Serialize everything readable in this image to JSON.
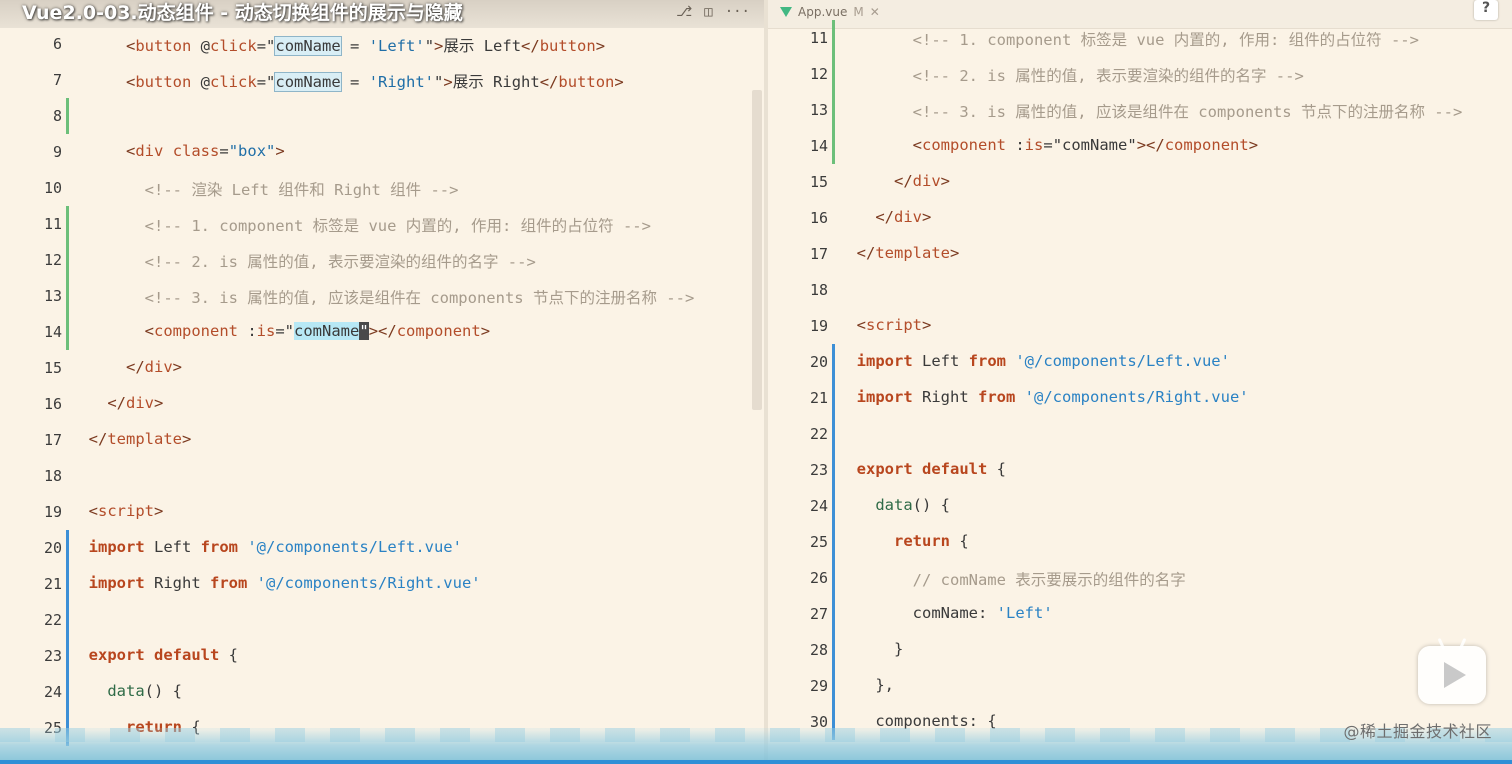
{
  "video_title": "Vue2.0-03.动态组件 - 动态切换组件的展示与隐藏",
  "left_pane": {
    "tab_partial": "App.vue M",
    "actions": [
      "⎇",
      "◫",
      "···"
    ],
    "lines": [
      {
        "n": "6",
        "gutter": "",
        "tokens": [
          [
            "      ",
            "tk-plain"
          ],
          [
            "<",
            "tk-tag"
          ],
          [
            "button",
            "tk-el"
          ],
          [
            " @",
            "tk-plain"
          ],
          [
            "click",
            "tk-dir"
          ],
          [
            "=\"",
            "tk-plain"
          ],
          [
            "comName",
            "hl"
          ],
          [
            " = ",
            "tk-plain"
          ],
          [
            "'Left'",
            "tk-str"
          ],
          [
            "\"",
            "tk-plain"
          ],
          [
            ">",
            "tk-tag"
          ],
          [
            "展示 Left",
            "tk-plain"
          ],
          [
            "</",
            "tk-tag"
          ],
          [
            "button",
            "tk-el"
          ],
          [
            ">",
            "tk-tag"
          ]
        ]
      },
      {
        "n": "7",
        "gutter": "",
        "tokens": [
          [
            "      ",
            "tk-plain"
          ],
          [
            "<",
            "tk-tag"
          ],
          [
            "button",
            "tk-el"
          ],
          [
            " @",
            "tk-plain"
          ],
          [
            "click",
            "tk-dir"
          ],
          [
            "=\"",
            "tk-plain"
          ],
          [
            "comName",
            "hl"
          ],
          [
            " = ",
            "tk-plain"
          ],
          [
            "'Right'",
            "tk-str"
          ],
          [
            "\"",
            "tk-plain"
          ],
          [
            ">",
            "tk-tag"
          ],
          [
            "展示 Right",
            "tk-plain"
          ],
          [
            "</",
            "tk-tag"
          ],
          [
            "button",
            "tk-el"
          ],
          [
            ">",
            "tk-tag"
          ]
        ]
      },
      {
        "n": "8",
        "gutter": "green",
        "tokens": []
      },
      {
        "n": "9",
        "gutter": "",
        "tokens": [
          [
            "      ",
            "tk-plain"
          ],
          [
            "<",
            "tk-tag"
          ],
          [
            "div",
            "tk-el"
          ],
          [
            " ",
            "tk-plain"
          ],
          [
            "class",
            "tk-attr"
          ],
          [
            "=",
            "tk-plain"
          ],
          [
            "\"box\"",
            "tk-str"
          ],
          [
            ">",
            "tk-tag"
          ]
        ]
      },
      {
        "n": "10",
        "gutter": "",
        "tokens": [
          [
            "        ",
            "tk-plain"
          ],
          [
            "<!-- 渲染 Left 组件和 Right 组件 -->",
            "tk-comment"
          ]
        ]
      },
      {
        "n": "11",
        "gutter": "green",
        "tokens": [
          [
            "        ",
            "tk-plain"
          ],
          [
            "<!-- 1. component 标签是 vue 内置的, 作用: 组件的占位符 -->",
            "tk-comment"
          ]
        ]
      },
      {
        "n": "12",
        "gutter": "green",
        "tokens": [
          [
            "        ",
            "tk-plain"
          ],
          [
            "<!-- 2. is 属性的值, 表示要渲染的组件的名字 -->",
            "tk-comment"
          ]
        ]
      },
      {
        "n": "13",
        "gutter": "green",
        "tokens": [
          [
            "        ",
            "tk-plain"
          ],
          [
            "<!-- 3. is 属性的值, 应该是组件在 components 节点下的注册名称 -->",
            "tk-comment"
          ]
        ]
      },
      {
        "n": "14",
        "gutter": "green",
        "tokens": [
          [
            "        ",
            "tk-plain"
          ],
          [
            "<",
            "tk-tag"
          ],
          [
            "component",
            "tk-el"
          ],
          [
            " :",
            "tk-plain"
          ],
          [
            "is",
            "tk-dir"
          ],
          [
            "=\"",
            "tk-plain"
          ],
          [
            "comName",
            "sel"
          ],
          [
            "\"",
            "cursor"
          ],
          [
            ">",
            "tk-tag"
          ],
          [
            "</",
            "tk-tag"
          ],
          [
            "component",
            "tk-el"
          ],
          [
            ">",
            "tk-tag"
          ]
        ]
      },
      {
        "n": "15",
        "gutter": "",
        "tokens": [
          [
            "      ",
            "tk-plain"
          ],
          [
            "</",
            "tk-tag"
          ],
          [
            "div",
            "tk-el"
          ],
          [
            ">",
            "tk-tag"
          ]
        ]
      },
      {
        "n": "16",
        "gutter": "",
        "tokens": [
          [
            "    ",
            "tk-plain"
          ],
          [
            "</",
            "tk-tag"
          ],
          [
            "div",
            "tk-el"
          ],
          [
            ">",
            "tk-tag"
          ]
        ]
      },
      {
        "n": "17",
        "gutter": "",
        "tokens": [
          [
            "  ",
            "tk-plain"
          ],
          [
            "</",
            "tk-tag"
          ],
          [
            "template",
            "tk-el"
          ],
          [
            ">",
            "tk-tag"
          ]
        ]
      },
      {
        "n": "18",
        "gutter": "",
        "tokens": []
      },
      {
        "n": "19",
        "gutter": "",
        "tokens": [
          [
            "  ",
            "tk-plain"
          ],
          [
            "<",
            "tk-tag"
          ],
          [
            "script",
            "tk-el"
          ],
          [
            ">",
            "tk-tag"
          ]
        ]
      },
      {
        "n": "20",
        "gutter": "blue",
        "tokens": [
          [
            "  ",
            "tk-plain"
          ],
          [
            "import",
            "tk-kw"
          ],
          [
            " Left ",
            "tk-plain"
          ],
          [
            "from",
            "tk-kw"
          ],
          [
            " ",
            "tk-plain"
          ],
          [
            "'@/components/Left.vue'",
            "tk-strblue"
          ]
        ]
      },
      {
        "n": "21",
        "gutter": "blue",
        "tokens": [
          [
            "  ",
            "tk-plain"
          ],
          [
            "import",
            "tk-kw"
          ],
          [
            " Right ",
            "tk-plain"
          ],
          [
            "from",
            "tk-kw"
          ],
          [
            " ",
            "tk-plain"
          ],
          [
            "'@/components/Right.vue'",
            "tk-strblue"
          ]
        ]
      },
      {
        "n": "22",
        "gutter": "blue",
        "tokens": []
      },
      {
        "n": "23",
        "gutter": "blue",
        "tokens": [
          [
            "  ",
            "tk-plain"
          ],
          [
            "export",
            "tk-kw"
          ],
          [
            " ",
            "tk-plain"
          ],
          [
            "default",
            "tk-kw"
          ],
          [
            " {",
            "tk-plain"
          ]
        ]
      },
      {
        "n": "24",
        "gutter": "blue",
        "tokens": [
          [
            "    ",
            "tk-plain"
          ],
          [
            "data",
            "tk-ident"
          ],
          [
            "() {",
            "tk-plain"
          ]
        ]
      },
      {
        "n": "25",
        "gutter": "blue",
        "tokens": [
          [
            "      ",
            "tk-plain"
          ],
          [
            "return",
            "tk-kw"
          ],
          [
            " {",
            "tk-plain"
          ]
        ]
      }
    ]
  },
  "right_pane": {
    "tab_label": "App.vue",
    "tab_modified": "M",
    "tab_close": "✕",
    "help": "?",
    "lines": [
      {
        "n": "11",
        "gutter": "green",
        "tokens": [
          [
            "        ",
            "tk-plain"
          ],
          [
            "<!-- 1. component 标签是 vue 内置的, 作用: 组件的占位符 -->",
            "tk-comment"
          ]
        ]
      },
      {
        "n": "12",
        "gutter": "green",
        "tokens": [
          [
            "        ",
            "tk-plain"
          ],
          [
            "<!-- 2. is 属性的值, 表示要渲染的组件的名字 -->",
            "tk-comment"
          ]
        ]
      },
      {
        "n": "13",
        "gutter": "green",
        "tokens": [
          [
            "        ",
            "tk-plain"
          ],
          [
            "<!-- 3. is 属性的值, 应该是组件在 components 节点下的注册名称 -->",
            "tk-comment"
          ]
        ]
      },
      {
        "n": "14",
        "gutter": "green",
        "tokens": [
          [
            "        ",
            "tk-plain"
          ],
          [
            "<",
            "tk-tag"
          ],
          [
            "component",
            "tk-el"
          ],
          [
            " :",
            "tk-plain"
          ],
          [
            "is",
            "tk-dir"
          ],
          [
            "=",
            "tk-plain"
          ],
          [
            "\"comName\"",
            "tk-plain"
          ],
          [
            ">",
            "tk-tag"
          ],
          [
            "</",
            "tk-tag"
          ],
          [
            "component",
            "tk-el"
          ],
          [
            ">",
            "tk-tag"
          ]
        ]
      },
      {
        "n": "15",
        "gutter": "",
        "tokens": [
          [
            "      ",
            "tk-plain"
          ],
          [
            "</",
            "tk-tag"
          ],
          [
            "div",
            "tk-el"
          ],
          [
            ">",
            "tk-tag"
          ]
        ]
      },
      {
        "n": "16",
        "gutter": "",
        "tokens": [
          [
            "    ",
            "tk-plain"
          ],
          [
            "</",
            "tk-tag"
          ],
          [
            "div",
            "tk-el"
          ],
          [
            ">",
            "tk-tag"
          ]
        ]
      },
      {
        "n": "17",
        "gutter": "",
        "tokens": [
          [
            "  ",
            "tk-plain"
          ],
          [
            "</",
            "tk-tag"
          ],
          [
            "template",
            "tk-el"
          ],
          [
            ">",
            "tk-tag"
          ]
        ]
      },
      {
        "n": "18",
        "gutter": "",
        "tokens": []
      },
      {
        "n": "19",
        "gutter": "",
        "tokens": [
          [
            "  ",
            "tk-plain"
          ],
          [
            "<",
            "tk-tag"
          ],
          [
            "script",
            "tk-el"
          ],
          [
            ">",
            "tk-tag"
          ]
        ]
      },
      {
        "n": "20",
        "gutter": "blue",
        "tokens": [
          [
            "  ",
            "tk-plain"
          ],
          [
            "import",
            "tk-kw"
          ],
          [
            " Left ",
            "tk-plain"
          ],
          [
            "from",
            "tk-kw"
          ],
          [
            " ",
            "tk-plain"
          ],
          [
            "'@/components/Left.vue'",
            "tk-strblue"
          ]
        ]
      },
      {
        "n": "21",
        "gutter": "blue",
        "tokens": [
          [
            "  ",
            "tk-plain"
          ],
          [
            "import",
            "tk-kw"
          ],
          [
            " Right ",
            "tk-plain"
          ],
          [
            "from",
            "tk-kw"
          ],
          [
            " ",
            "tk-plain"
          ],
          [
            "'@/components/Right.vue'",
            "tk-strblue"
          ]
        ]
      },
      {
        "n": "22",
        "gutter": "blue",
        "tokens": []
      },
      {
        "n": "23",
        "gutter": "blue",
        "tokens": [
          [
            "  ",
            "tk-plain"
          ],
          [
            "export",
            "tk-kw"
          ],
          [
            " ",
            "tk-plain"
          ],
          [
            "default",
            "tk-kw"
          ],
          [
            " {",
            "tk-plain"
          ]
        ]
      },
      {
        "n": "24",
        "gutter": "blue",
        "tokens": [
          [
            "    ",
            "tk-plain"
          ],
          [
            "data",
            "tk-ident"
          ],
          [
            "() {",
            "tk-plain"
          ]
        ]
      },
      {
        "n": "25",
        "gutter": "blue",
        "tokens": [
          [
            "      ",
            "tk-plain"
          ],
          [
            "return",
            "tk-kw"
          ],
          [
            " {",
            "tk-plain"
          ]
        ]
      },
      {
        "n": "26",
        "gutter": "blue",
        "tokens": [
          [
            "        ",
            "tk-plain"
          ],
          [
            "// comName 表示要展示的组件的名字",
            "tk-comment"
          ]
        ]
      },
      {
        "n": "27",
        "gutter": "blue",
        "tokens": [
          [
            "        ",
            "tk-plain"
          ],
          [
            "comName",
            "tk-plain"
          ],
          [
            ": ",
            "tk-plain"
          ],
          [
            "'Left'",
            "tk-strblue"
          ]
        ]
      },
      {
        "n": "28",
        "gutter": "blue",
        "tokens": [
          [
            "      ",
            "tk-plain"
          ],
          [
            "}",
            "tk-plain"
          ]
        ]
      },
      {
        "n": "29",
        "gutter": "blue",
        "tokens": [
          [
            "    ",
            "tk-plain"
          ],
          [
            "},",
            "tk-plain"
          ]
        ]
      },
      {
        "n": "30",
        "gutter": "blue",
        "tokens": [
          [
            "    ",
            "tk-plain"
          ],
          [
            "components",
            "tk-plain"
          ],
          [
            ": {",
            "tk-plain"
          ]
        ]
      }
    ]
  },
  "watermark": "@稀土掘金技术社区",
  "colors": {
    "background": "#fbf3e6",
    "gutter_green": "#6cbf7a",
    "gutter_blue": "#3d8fd6",
    "bottom_bar": "#2f8fd6"
  }
}
